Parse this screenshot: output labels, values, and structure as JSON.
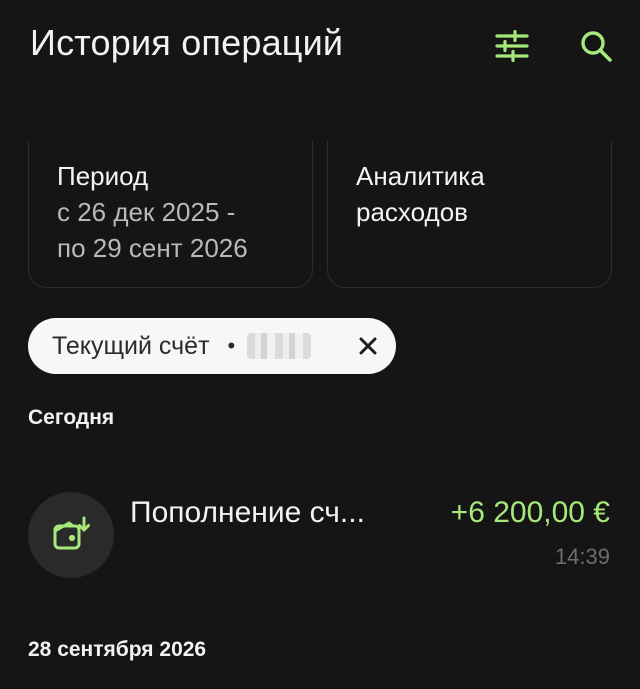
{
  "header": {
    "title": "История операций",
    "filter_icon": "filter-sliders-icon",
    "search_icon": "search-icon"
  },
  "cards": {
    "period": {
      "title": "Период",
      "line1": "с 26 дек 2025 -",
      "line2": "по 29 сент 2026"
    },
    "analytics": {
      "line1": "Аналитика",
      "line2": "расходов"
    }
  },
  "account_chip": {
    "label": "Текущий счёт",
    "separator": "•",
    "close_icon": "close-icon"
  },
  "sections": {
    "today": "Сегодня",
    "previous_date": "28 сентября 2026"
  },
  "transactions": [
    {
      "title": "Пополнение сч...",
      "amount": "+6 200,00 €",
      "time": "14:39",
      "icon": "wallet-deposit-icon"
    }
  ],
  "colors": {
    "background": "#151515",
    "accent": "#a6e87a",
    "text_primary": "#f2f2f2",
    "text_secondary": "#b9b9b9",
    "chip_background": "#f7f7f7"
  }
}
